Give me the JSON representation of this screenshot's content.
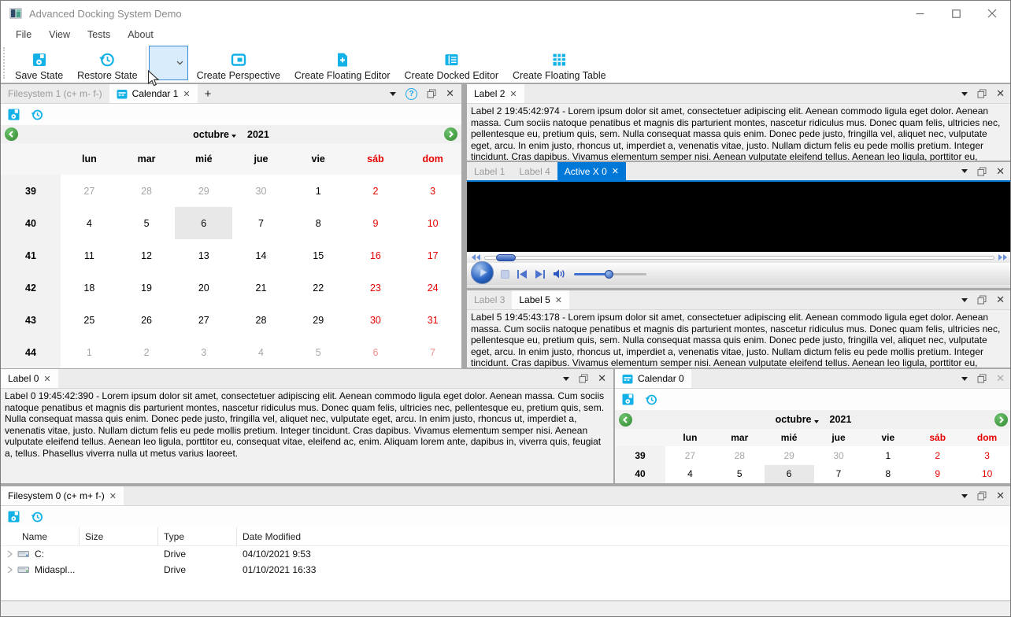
{
  "window": {
    "title": "Advanced Docking System Demo"
  },
  "menu": {
    "items": [
      "File",
      "View",
      "Tests",
      "About"
    ]
  },
  "toolbar": {
    "save_state": "Save State",
    "restore_state": "Restore State",
    "perspective_combo_value": "",
    "create_perspective": "Create Perspective",
    "create_floating_editor": "Create Floating Editor",
    "create_docked_editor": "Create Docked Editor",
    "create_floating_table": "Create Floating Table"
  },
  "calendar": {
    "month": "octubre",
    "year": "2021",
    "day_headers": [
      [
        "lun",
        "wd"
      ],
      [
        "mar",
        "wd"
      ],
      [
        "mié",
        "wd"
      ],
      [
        "jue",
        "wd"
      ],
      [
        "vie",
        "wd"
      ],
      [
        "sáb",
        "we"
      ],
      [
        "dom",
        "we"
      ]
    ],
    "weeks": [
      {
        "n": "39",
        "d": [
          [
            "27",
            "out"
          ],
          [
            "28",
            "out"
          ],
          [
            "29",
            "out"
          ],
          [
            "30",
            "out"
          ],
          [
            "1",
            "wd"
          ],
          [
            "2",
            "we"
          ],
          [
            "3",
            "we"
          ]
        ]
      },
      {
        "n": "40",
        "d": [
          [
            "4",
            "wd"
          ],
          [
            "5",
            "wd"
          ],
          [
            "6",
            "wd",
            "sel"
          ],
          [
            "7",
            "wd"
          ],
          [
            "8",
            "wd"
          ],
          [
            "9",
            "we"
          ],
          [
            "10",
            "we"
          ]
        ]
      },
      {
        "n": "41",
        "d": [
          [
            "11",
            "wd"
          ],
          [
            "12",
            "wd"
          ],
          [
            "13",
            "wd"
          ],
          [
            "14",
            "wd"
          ],
          [
            "15",
            "wd"
          ],
          [
            "16",
            "we"
          ],
          [
            "17",
            "we"
          ]
        ]
      },
      {
        "n": "42",
        "d": [
          [
            "18",
            "wd"
          ],
          [
            "19",
            "wd"
          ],
          [
            "20",
            "wd"
          ],
          [
            "21",
            "wd"
          ],
          [
            "22",
            "wd"
          ],
          [
            "23",
            "we"
          ],
          [
            "24",
            "we"
          ]
        ]
      },
      {
        "n": "43",
        "d": [
          [
            "25",
            "wd"
          ],
          [
            "26",
            "wd"
          ],
          [
            "27",
            "wd"
          ],
          [
            "28",
            "wd"
          ],
          [
            "29",
            "wd"
          ],
          [
            "30",
            "we"
          ],
          [
            "31",
            "we"
          ]
        ]
      },
      {
        "n": "44",
        "d": [
          [
            "1",
            "out"
          ],
          [
            "2",
            "out"
          ],
          [
            "3",
            "out"
          ],
          [
            "4",
            "out"
          ],
          [
            "5",
            "out"
          ],
          [
            "6",
            "oute"
          ],
          [
            "7",
            "oute"
          ]
        ]
      }
    ]
  },
  "docks": {
    "top_left": {
      "tabs": [
        {
          "label": "Filesystem 1 (c+ m- f-)"
        },
        {
          "label": "Calendar 1",
          "active": true,
          "icon": "calendar",
          "close": true
        }
      ],
      "add_tab": "+"
    },
    "label2": {
      "tabs": [
        {
          "label": "Label 2",
          "active": true,
          "close": true
        }
      ],
      "text": "Label 2 19:45:42:974 - Lorem ipsum dolor sit amet, consectetuer adipiscing elit. Aenean commodo ligula eget dolor. Aenean massa. Cum sociis natoque penatibus et magnis dis parturient montes, nascetur ridiculus mus. Donec quam felis, ultricies nec, pellentesque eu, pretium quis, sem. Nulla consequat massa quis enim. Donec pede justo, fringilla vel, aliquet nec, vulputate eget, arcu. In enim justo, rhoncus ut, imperdiet a, venenatis vitae, justo. Nullam dictum felis eu pede mollis pretium. Integer tincidunt. Cras dapibus. Vivamus elementum semper nisi. Aenean vulputate eleifend tellus. Aenean leo ligula, porttitor eu, consequat vitae, eleifend ac, enim. Aliquam"
    },
    "activex": {
      "tabs": [
        {
          "label": "Label 1"
        },
        {
          "label": "Label 4"
        },
        {
          "label": "Active X 0",
          "active": true,
          "accent": true,
          "close": true
        }
      ]
    },
    "label5": {
      "tabs": [
        {
          "label": "Label 3"
        },
        {
          "label": "Label 5",
          "active": true,
          "close": true
        }
      ],
      "text": "Label 5 19:45:43:178 - Lorem ipsum dolor sit amet, consectetuer adipiscing elit. Aenean commodo ligula eget dolor. Aenean massa. Cum sociis natoque penatibus et magnis dis parturient montes, nascetur ridiculus mus. Donec quam felis, ultricies nec, pellentesque eu, pretium quis, sem. Nulla consequat massa quis enim. Donec pede justo, fringilla vel, aliquet nec, vulputate eget, arcu. In enim justo, rhoncus ut, imperdiet a, venenatis vitae, justo. Nullam dictum felis eu pede mollis pretium. Integer tincidunt. Cras dapibus. Vivamus elementum semper nisi. Aenean vulputate eleifend tellus. Aenean leo ligula, porttitor eu, consequat vitae, eleifend ac, enim. Aliquam"
    },
    "label0": {
      "tabs": [
        {
          "label": "Label 0",
          "active": true,
          "close": true
        }
      ],
      "text": "Label 0 19:45:42:390 - Lorem ipsum dolor sit amet, consectetuer adipiscing elit. Aenean commodo ligula eget dolor. Aenean massa. Cum sociis natoque penatibus et magnis dis parturient montes, nascetur ridiculus mus. Donec quam felis, ultricies nec, pellentesque eu, pretium quis, sem. Nulla consequat massa quis enim. Donec pede justo, fringilla vel, aliquet nec, vulputate eget, arcu. In enim justo, rhoncus ut, imperdiet a, venenatis vitae, justo. Nullam dictum felis eu pede mollis pretium. Integer tincidunt. Cras dapibus. Vivamus elementum semper nisi. Aenean vulputate eleifend tellus. Aenean leo ligula, porttitor eu, consequat vitae, eleifend ac, enim. Aliquam lorem ante, dapibus in, viverra quis, feugiat a, tellus. Phasellus viverra nulla ut metus varius laoreet."
    },
    "calendar0": {
      "tabs": [
        {
          "label": "Calendar 0",
          "active": true,
          "icon": "calendar"
        }
      ]
    },
    "filesystem0": {
      "tabs": [
        {
          "label": "Filesystem 0 (c+ m+ f-)",
          "active": true,
          "close": true
        }
      ],
      "columns": [
        "Name",
        "Size",
        "Type",
        "Date Modified"
      ],
      "rows": [
        {
          "name": "C:",
          "size": "",
          "type": "Drive",
          "modified": "04/10/2021 9:53"
        },
        {
          "name": "Midaspl...",
          "size": "",
          "type": "Drive",
          "modified": "01/10/2021 16:33"
        }
      ]
    }
  },
  "colors": {
    "accent_blue": "#0078d7",
    "icon_cyan": "#14b1e7",
    "weekend_red": "#e60000",
    "nav_green": "#3f9d3f"
  }
}
